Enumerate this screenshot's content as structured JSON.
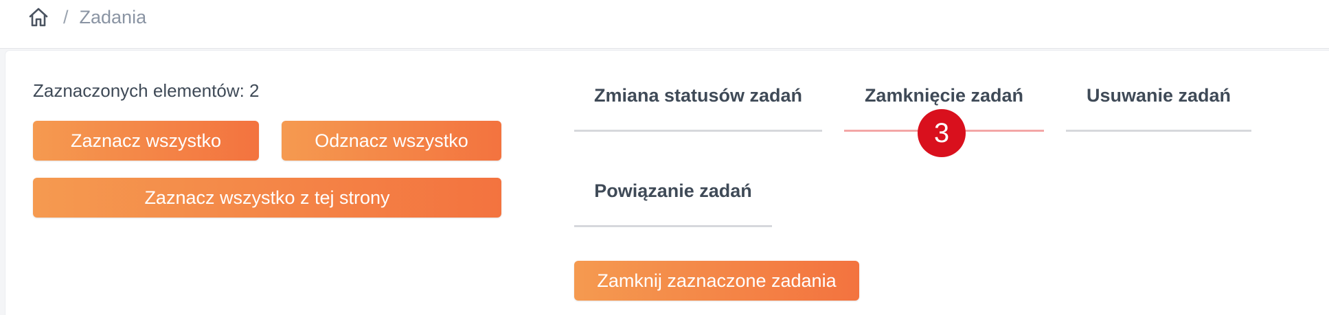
{
  "breadcrumb": {
    "home_icon": "home-icon",
    "separator": "/",
    "current": "Zadania"
  },
  "selection": {
    "count_label": "Zaznaczonych elementów: 2",
    "select_all": "Zaznacz wszystko",
    "deselect_all": "Odznacz wszystko",
    "select_page": "Zaznacz wszystko z tej strony"
  },
  "tabs": [
    {
      "label": "Zmiana statusów zadań",
      "active": false
    },
    {
      "label": "Zamknięcie zadań",
      "active": true
    },
    {
      "label": "Usuwanie zadań",
      "active": false
    },
    {
      "label": "Powiązanie zadań",
      "active": false
    }
  ],
  "action": {
    "close_selected": "Zamknij zaznaczone zadania"
  },
  "badge": {
    "value": "3"
  },
  "colors": {
    "accent_start": "#f59a50",
    "accent_end": "#f3733f",
    "badge": "#d9101d",
    "active_tab_line": "#f3a6a6"
  }
}
